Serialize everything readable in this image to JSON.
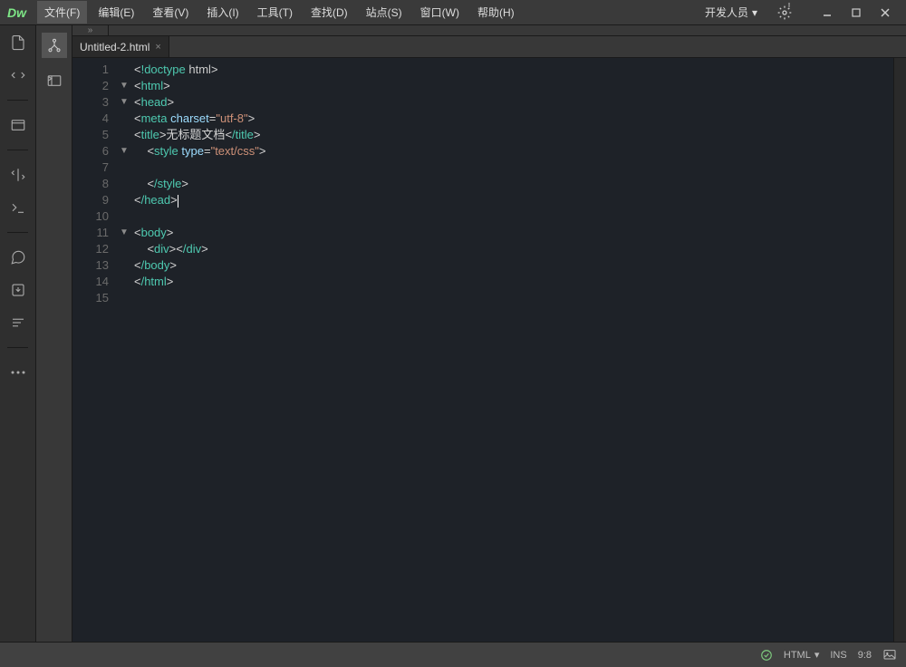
{
  "app": {
    "logo": "Dw"
  },
  "menu": {
    "file": "文件(F)",
    "edit": "编辑(E)",
    "view": "查看(V)",
    "insert": "插入(I)",
    "tools": "工具(T)",
    "find": "查找(D)",
    "site": "站点(S)",
    "window": "窗口(W)",
    "help": "帮助(H)",
    "dev": "开发人员"
  },
  "tab": {
    "filename": "Untitled-2.html"
  },
  "code": {
    "lines": [
      "<!doctype html>",
      "<html>",
      "<head>",
      "<meta charset=\"utf-8\">",
      "<title>无标题文档</title>",
      "    <style type=\"text/css\">",
      "",
      "    </style>",
      "</head>",
      "",
      "<body>",
      "    <div></div>",
      "</body>",
      "</html>",
      ""
    ],
    "fold": [
      "",
      "▼",
      "▼",
      "",
      "",
      "▼",
      "",
      "",
      "",
      "",
      "▼",
      "",
      "",
      "",
      ""
    ]
  },
  "status": {
    "errors": "0",
    "mode": "HTML",
    "ins": "INS",
    "cursor_pos": "9:8"
  }
}
